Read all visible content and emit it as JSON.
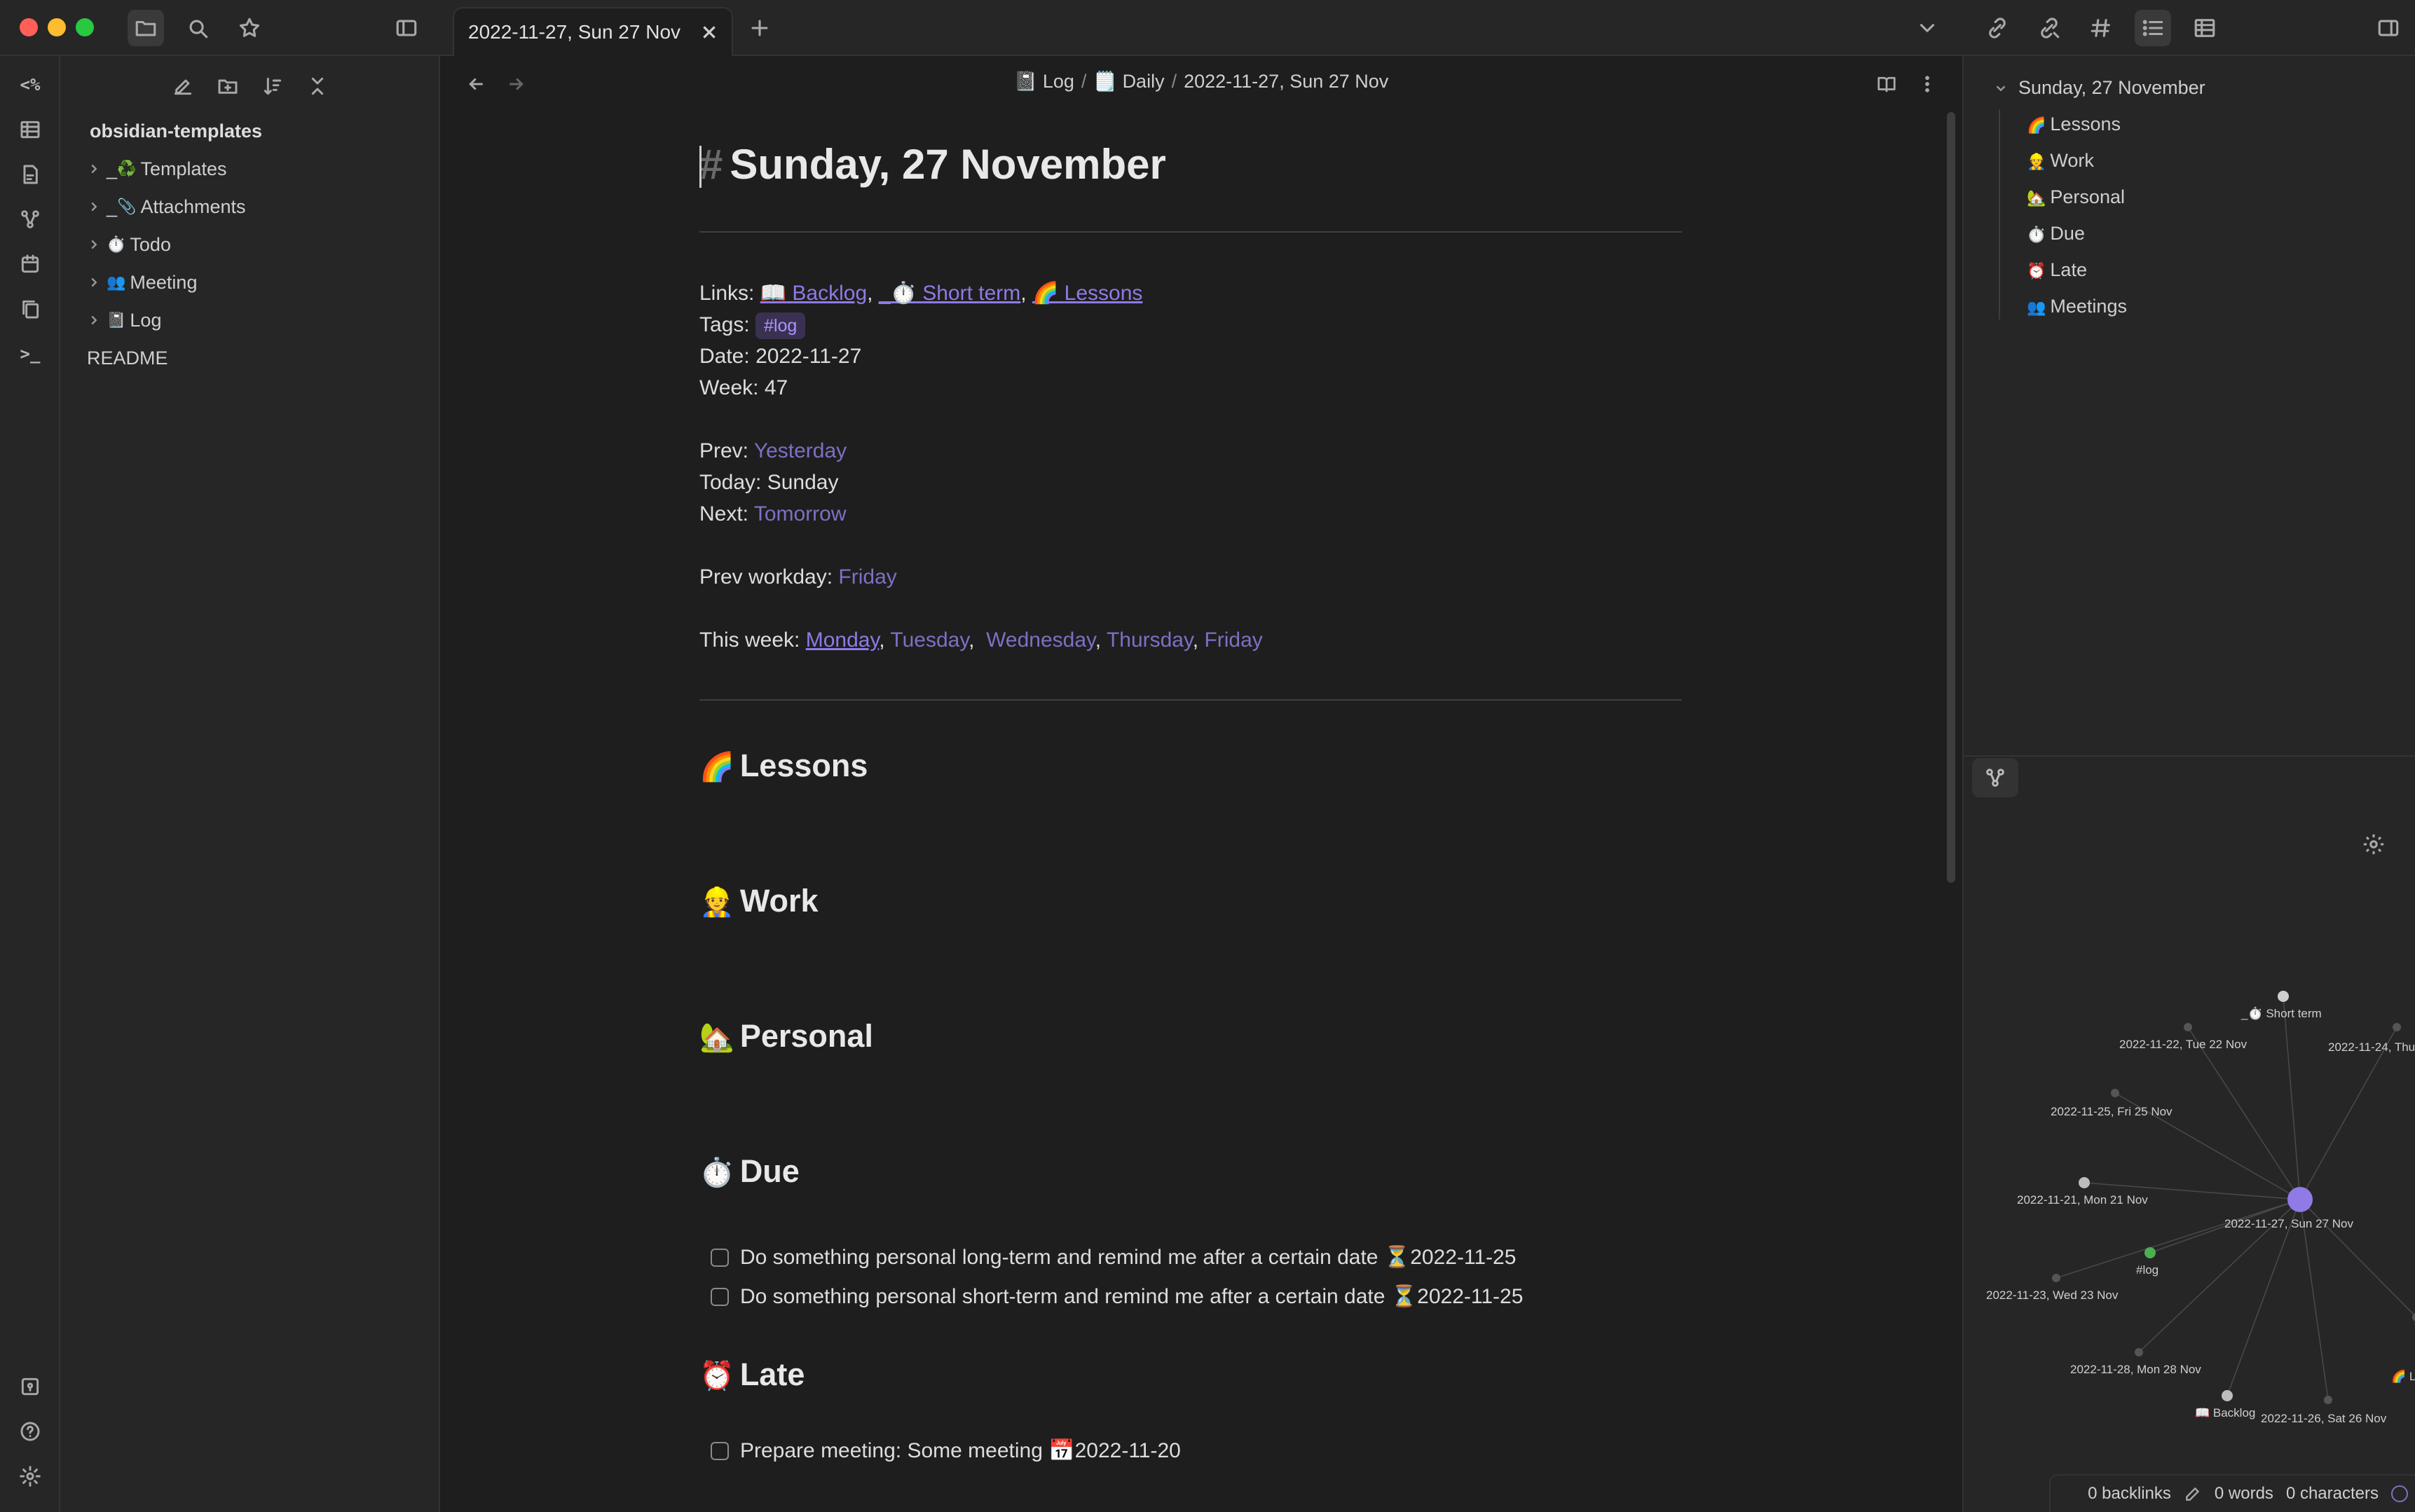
{
  "window": {
    "tab_title": "2022-11-27, Sun 27 Nov"
  },
  "ribbon": {
    "templater_label": "<%",
    "terminal_label": ">_"
  },
  "explorer": {
    "vault_name": "obsidian-templates",
    "items": [
      {
        "emoji": "♻️",
        "label": "Templates",
        "prefix": "_"
      },
      {
        "emoji": "📎",
        "label": "Attachments",
        "prefix": "_"
      },
      {
        "emoji": "⏱️",
        "label": "Todo",
        "prefix": ""
      },
      {
        "emoji": "👥",
        "label": "Meeting",
        "prefix": ""
      },
      {
        "emoji": "📓",
        "label": "Log",
        "prefix": ""
      },
      {
        "emoji": "",
        "label": "README",
        "prefix": ""
      }
    ]
  },
  "breadcrumb": {
    "log_emoji": "📓",
    "log": "Log",
    "daily_emoji": "🗒️",
    "daily": "Daily",
    "current": "2022-11-27, Sun 27 Nov",
    "separator": "/"
  },
  "note": {
    "title": "Sunday, 27 November",
    "hash": "#",
    "links_label": "Links:",
    "links": [
      {
        "emoji": "📖",
        "text": "Backlog"
      },
      {
        "emoji": "⏱️",
        "text": "Short term",
        "prefix": "_"
      },
      {
        "emoji": "🌈",
        "text": "Lessons"
      }
    ],
    "tags_label": "Tags:",
    "tag": "#log",
    "date_label": "Date:",
    "date_value": "2022-11-27",
    "week_label": "Week:",
    "week_value": "47",
    "prev_label": "Prev:",
    "prev_link": "Yesterday",
    "today_label": "Today:",
    "today_value": "Sunday",
    "next_label": "Next:",
    "next_link": "Tomorrow",
    "prev_workday_label": "Prev workday:",
    "prev_workday_link": "Friday",
    "this_week_label": "This week:",
    "week_days": [
      "Monday",
      "Tuesday",
      "Wednesday",
      "Thursday",
      "Friday"
    ],
    "sections": {
      "lessons": {
        "emoji": "🌈",
        "title": "Lessons"
      },
      "work": {
        "emoji": "👷",
        "title": "Work"
      },
      "personal": {
        "emoji": "🏡",
        "title": "Personal"
      },
      "due": {
        "emoji": "⏱️",
        "title": "Due"
      },
      "late": {
        "emoji": "⏰",
        "title": "Late"
      }
    },
    "due_tasks": [
      {
        "text": "Do something personal long-term and remind me after a certain date",
        "date_emoji": "⏳",
        "date": "2022-11-25"
      },
      {
        "text": "Do something personal short-term and remind me after a certain date",
        "date_emoji": "⏳",
        "date": "2022-11-25"
      }
    ],
    "late_task_partial": {
      "text": "Prepare meeting: Some meeting",
      "date_emoji": "📅",
      "date": "2022-11-20"
    }
  },
  "outline": {
    "heading": "Sunday, 27 November",
    "items": [
      {
        "emoji": "🌈",
        "label": "Lessons"
      },
      {
        "emoji": "👷",
        "label": "Work"
      },
      {
        "emoji": "🏡",
        "label": "Personal"
      },
      {
        "emoji": "⏱️",
        "label": "Due"
      },
      {
        "emoji": "⏰",
        "label": "Late"
      },
      {
        "emoji": "👥",
        "label": "Meetings"
      }
    ]
  },
  "graph": {
    "center": "2022-11-27, Sun 27 Nov",
    "nodes": [
      "_⏱️ Short term",
      "2022-11-22, Tue 22 Nov",
      "2022-11-24, Thu",
      "2022-11-25, Fri 25 Nov",
      "2022-11-21, Mon 21 Nov",
      "#log",
      "2022-11-23, Wed 23 Nov",
      "2022-11-28, Mon 28 Nov",
      "📖 Backlog",
      "2022-11-26, Sat 26 Nov",
      "🌈 Le"
    ],
    "accent": "#8f7ae6",
    "tag_color": "#4caf50"
  },
  "status": {
    "backlinks": "0 backlinks",
    "words": "0 words",
    "characters": "0 characters"
  },
  "colors": {
    "accent": "#8f7ae6",
    "background": "#1e1e1e",
    "sidebar": "#262626"
  }
}
